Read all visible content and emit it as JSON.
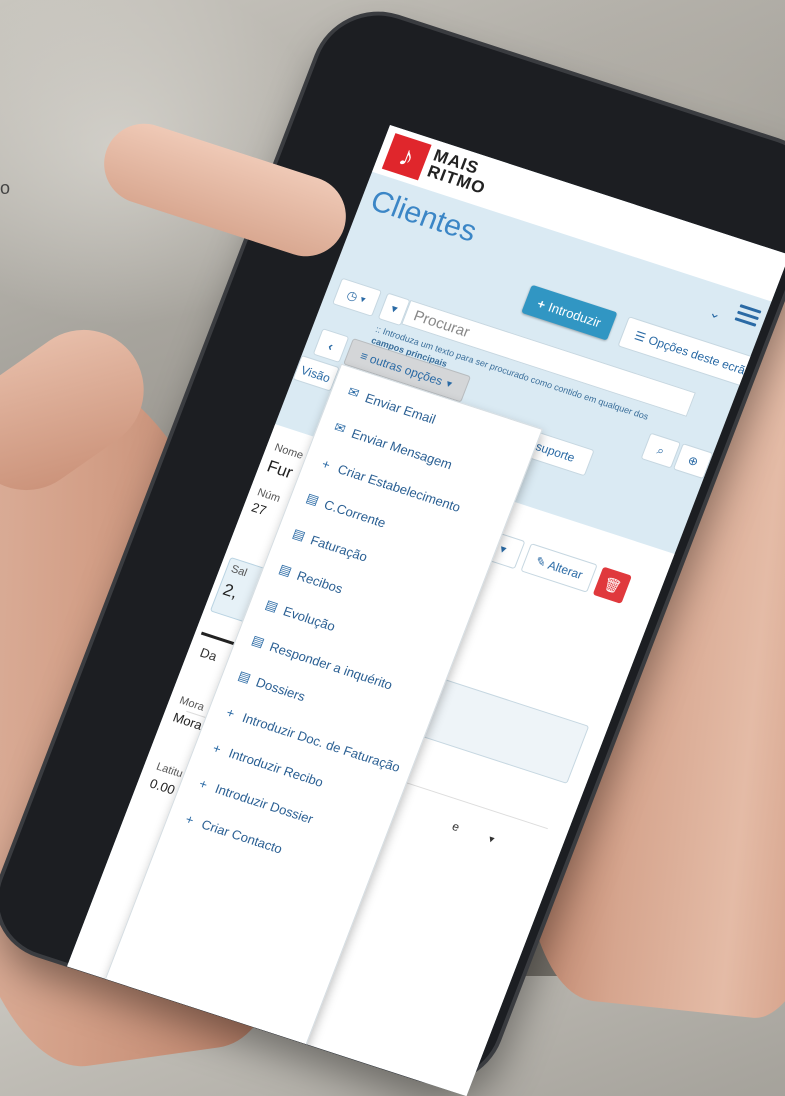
{
  "stray_text": "o",
  "app": {
    "logo_glyph": "♪",
    "logo_line1": "MAIS",
    "logo_line2": "RITMO",
    "brand_color": "#e0262c"
  },
  "page": {
    "title": "Clientes",
    "introduzir_label": "Introduzir",
    "opcoes_label": "Opções deste ecrã"
  },
  "search": {
    "placeholder": "Procurar",
    "help_text": ":: Introduza um texto para ser procurado como contido em qualquer dos",
    "help_bold": "campos principais"
  },
  "toolbar": {
    "outras_opcoes_label": "outras opções",
    "visao_label": "Visão",
    "visao_suporte_label": "Visão do suporte",
    "alterar_label": "Alterar"
  },
  "record": {
    "nome_label": "Nome",
    "nome_value": "Fur",
    "numero_label": "Núm",
    "numero_value": "27",
    "saldo_label": "Sal",
    "saldo_value": "2,",
    "tab_label": "Da",
    "morada_label": "Mora",
    "morada_value": "Mora",
    "latitude_label": "Latitu",
    "latitude_value": "0.00",
    "select_value": "e"
  },
  "dropdown": {
    "items": [
      {
        "icon": "envelope-outline-icon",
        "glyph": "✉",
        "label": "Enviar Email"
      },
      {
        "icon": "envelope-icon",
        "glyph": "✉",
        "label": "Enviar Mensagem"
      },
      {
        "icon": "plus-icon",
        "glyph": "+",
        "label": "Criar Estabelecimento"
      },
      {
        "icon": "document-icon",
        "glyph": "▤",
        "label": "C.Corrente"
      },
      {
        "icon": "document-icon",
        "glyph": "▤",
        "label": "Faturação"
      },
      {
        "icon": "document-icon",
        "glyph": "▤",
        "label": "Recibos"
      },
      {
        "icon": "document-icon",
        "glyph": "▤",
        "label": "Evolução"
      },
      {
        "icon": "document-icon",
        "glyph": "▤",
        "label": "Responder a inquérito"
      },
      {
        "icon": "document-icon",
        "glyph": "▤",
        "label": "Dossiers"
      },
      {
        "icon": "plus-icon",
        "glyph": "+",
        "label": "Introduzir Doc. de Faturação"
      },
      {
        "icon": "plus-icon",
        "glyph": "+",
        "label": "Introduzir Recibo"
      },
      {
        "icon": "plus-icon",
        "glyph": "+",
        "label": "Introduzir Dossier"
      },
      {
        "icon": "plus-icon",
        "glyph": "+",
        "label": "Criar Contacto"
      }
    ]
  }
}
